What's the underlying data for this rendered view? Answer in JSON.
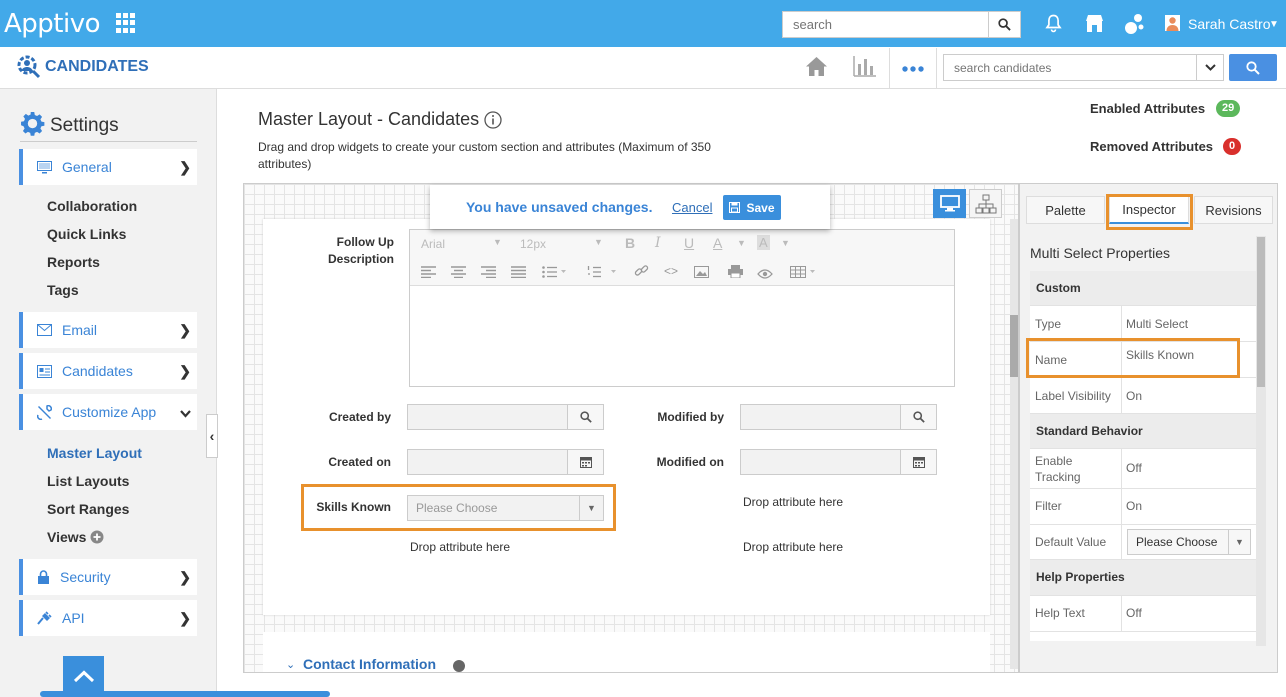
{
  "topbar": {
    "logo": "Apptivo",
    "search_placeholder": "search",
    "user_name": "Sarah Castro"
  },
  "appbar": {
    "title": "CANDIDATES",
    "search_placeholder": "search candidates"
  },
  "sidebar": {
    "title": "Settings",
    "items": [
      {
        "label": "General"
      },
      {
        "label": "Email"
      },
      {
        "label": "Candidates"
      },
      {
        "label": "Customize App"
      },
      {
        "label": "Security"
      },
      {
        "label": "API"
      }
    ],
    "general_sub": [
      "Collaboration",
      "Quick Links",
      "Reports",
      "Tags"
    ],
    "customize_sub": [
      "Master Layout",
      "List Layouts",
      "Sort Ranges",
      "Views"
    ]
  },
  "main": {
    "title": "Master Layout - Candidates",
    "description": "Drag and drop widgets to create your custom section and attributes (Maximum of 350 attributes)",
    "enabled_label": "Enabled Attributes",
    "enabled_count": "29",
    "removed_label": "Removed Attributes",
    "removed_count": "0",
    "unsaved_text": "You have unsaved changes.",
    "cancel_label": "Cancel",
    "save_label": "Save",
    "editor": {
      "font": "Arial",
      "size": "12px"
    },
    "fields": {
      "follow_up": "Follow Up Description",
      "created_by": "Created by",
      "modified_by": "Modified by",
      "created_on": "Created on",
      "modified_on": "Modified on",
      "skills_known": "Skills Known",
      "skills_placeholder": "Please Choose",
      "drop_here": "Drop attribute here"
    },
    "next_section": "Contact Information"
  },
  "inspector": {
    "tabs": [
      "Palette",
      "Inspector",
      "Revisions"
    ],
    "title": "Multi Select Properties",
    "custom_header": "Custom",
    "type_label": "Type",
    "type_value": "Multi Select",
    "name_label": "Name",
    "name_value": "Skills Known",
    "label_visibility_label": "Label Visibility",
    "label_visibility_value": "On",
    "standard_header": "Standard Behavior",
    "enable_tracking_label": "Enable Tracking",
    "enable_tracking_value": "Off",
    "filter_label": "Filter",
    "filter_value": "On",
    "default_value_label": "Default Value",
    "default_value_value": "Please Choose",
    "help_header": "Help Properties",
    "help_text_label": "Help Text",
    "help_text_value": "Off"
  },
  "colors": {
    "brand": "#42a9e9",
    "accent": "#3a8fdc",
    "highlight": "#e8912d",
    "enabled_badge": "#5cb85c",
    "removed_badge": "#d9302c"
  }
}
